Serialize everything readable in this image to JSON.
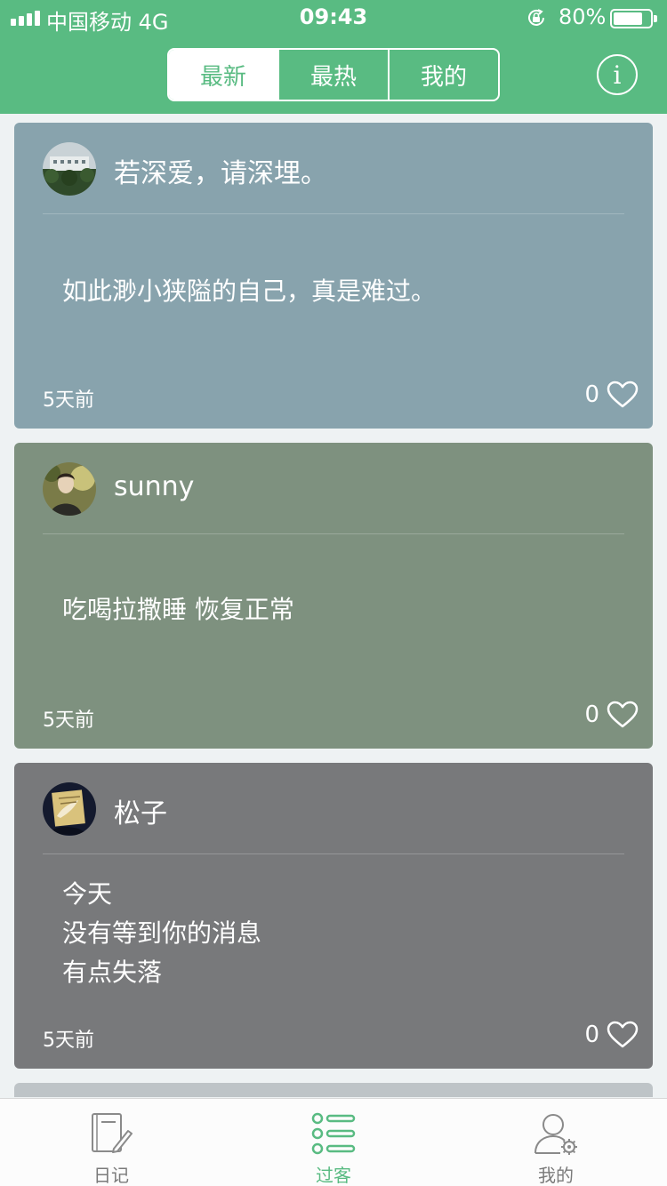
{
  "status_bar": {
    "carrier": "中国移动  4G",
    "time": "09:43",
    "battery": "80%",
    "battery_level": 0.8
  },
  "header": {
    "tabs": [
      {
        "label": "最新",
        "active": true
      },
      {
        "label": "最热",
        "active": false
      },
      {
        "label": "我的",
        "active": false
      }
    ],
    "info_icon": "info-icon",
    "info_label": "i",
    "accent_color": "#59bb82"
  },
  "posts": [
    {
      "author": "若深爱，请深埋。",
      "lines": [
        "如此渺小狭隘的自己，真是难过。"
      ],
      "time": "5天前",
      "likes": "0",
      "bg": "#88a3ad",
      "avatar_icon": "building-photo-avatar"
    },
    {
      "author": "sunny",
      "lines": [
        "吃喝拉撒睡 恢复正常"
      ],
      "time": "5天前",
      "likes": "0",
      "bg": "#7e917f",
      "avatar_icon": "portrait-photo-avatar"
    },
    {
      "author": "松子",
      "lines": [
        "今天",
        "没有等到你的消息",
        "有点失落"
      ],
      "time": "5天前",
      "likes": "0",
      "bg": "#78797b",
      "avatar_icon": "illustration-avatar"
    }
  ],
  "tabbar": {
    "items": [
      {
        "label": "日记",
        "icon": "notebook-pen-icon",
        "active": false
      },
      {
        "label": "过客",
        "icon": "list-icon",
        "active": true
      },
      {
        "label": "我的",
        "icon": "user-settings-icon",
        "active": false
      }
    ]
  }
}
